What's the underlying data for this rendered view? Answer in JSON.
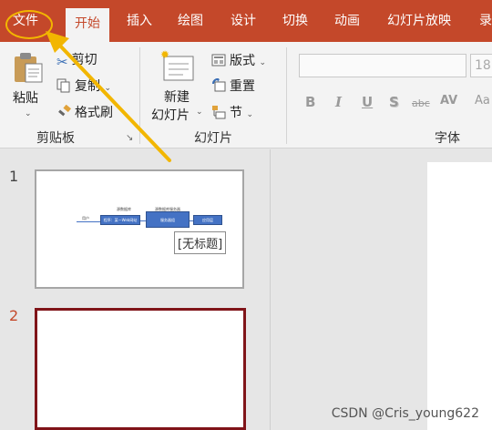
{
  "tabs": [
    {
      "label": "文件",
      "active": false
    },
    {
      "label": "开始",
      "active": true
    },
    {
      "label": "插入",
      "active": false
    },
    {
      "label": "绘图",
      "active": false
    },
    {
      "label": "设计",
      "active": false
    },
    {
      "label": "切换",
      "active": false
    },
    {
      "label": "动画",
      "active": false
    },
    {
      "label": "幻灯片放映",
      "active": false
    },
    {
      "label": "录",
      "active": false
    }
  ],
  "clipboard": {
    "paste_label": "粘贴",
    "cut_label": "剪切",
    "copy_label": "复制",
    "format_painter_label": "格式刷",
    "group_label": "剪贴板"
  },
  "slides_group": {
    "new_slide_line1": "新建",
    "new_slide_line2": "幻灯片",
    "layout_label": "版式",
    "reset_label": "重置",
    "section_label": "节",
    "group_label": "幻灯片"
  },
  "font_group": {
    "font_name": "",
    "font_size": "18",
    "bold": "B",
    "italic": "I",
    "underline": "U",
    "shadow": "S",
    "strike": "abc",
    "spacing": "AV",
    "case": "Aa",
    "group_label": "字体"
  },
  "slide_panel": {
    "numbers": [
      "1",
      "2"
    ],
    "tooltip": "[无标题]",
    "mini_labels": {
      "top_left": "源数据库",
      "top_right": "源数据库服务器",
      "left": "用户",
      "box1": "程序：某一Web网站",
      "box2": "服务器组",
      "box3": "应用层"
    }
  },
  "colors": {
    "tab_bar": "#c4482a",
    "highlight": "#f2b600",
    "selected_slide_border": "#801419"
  },
  "watermark": "CSDN @Cris_young622"
}
